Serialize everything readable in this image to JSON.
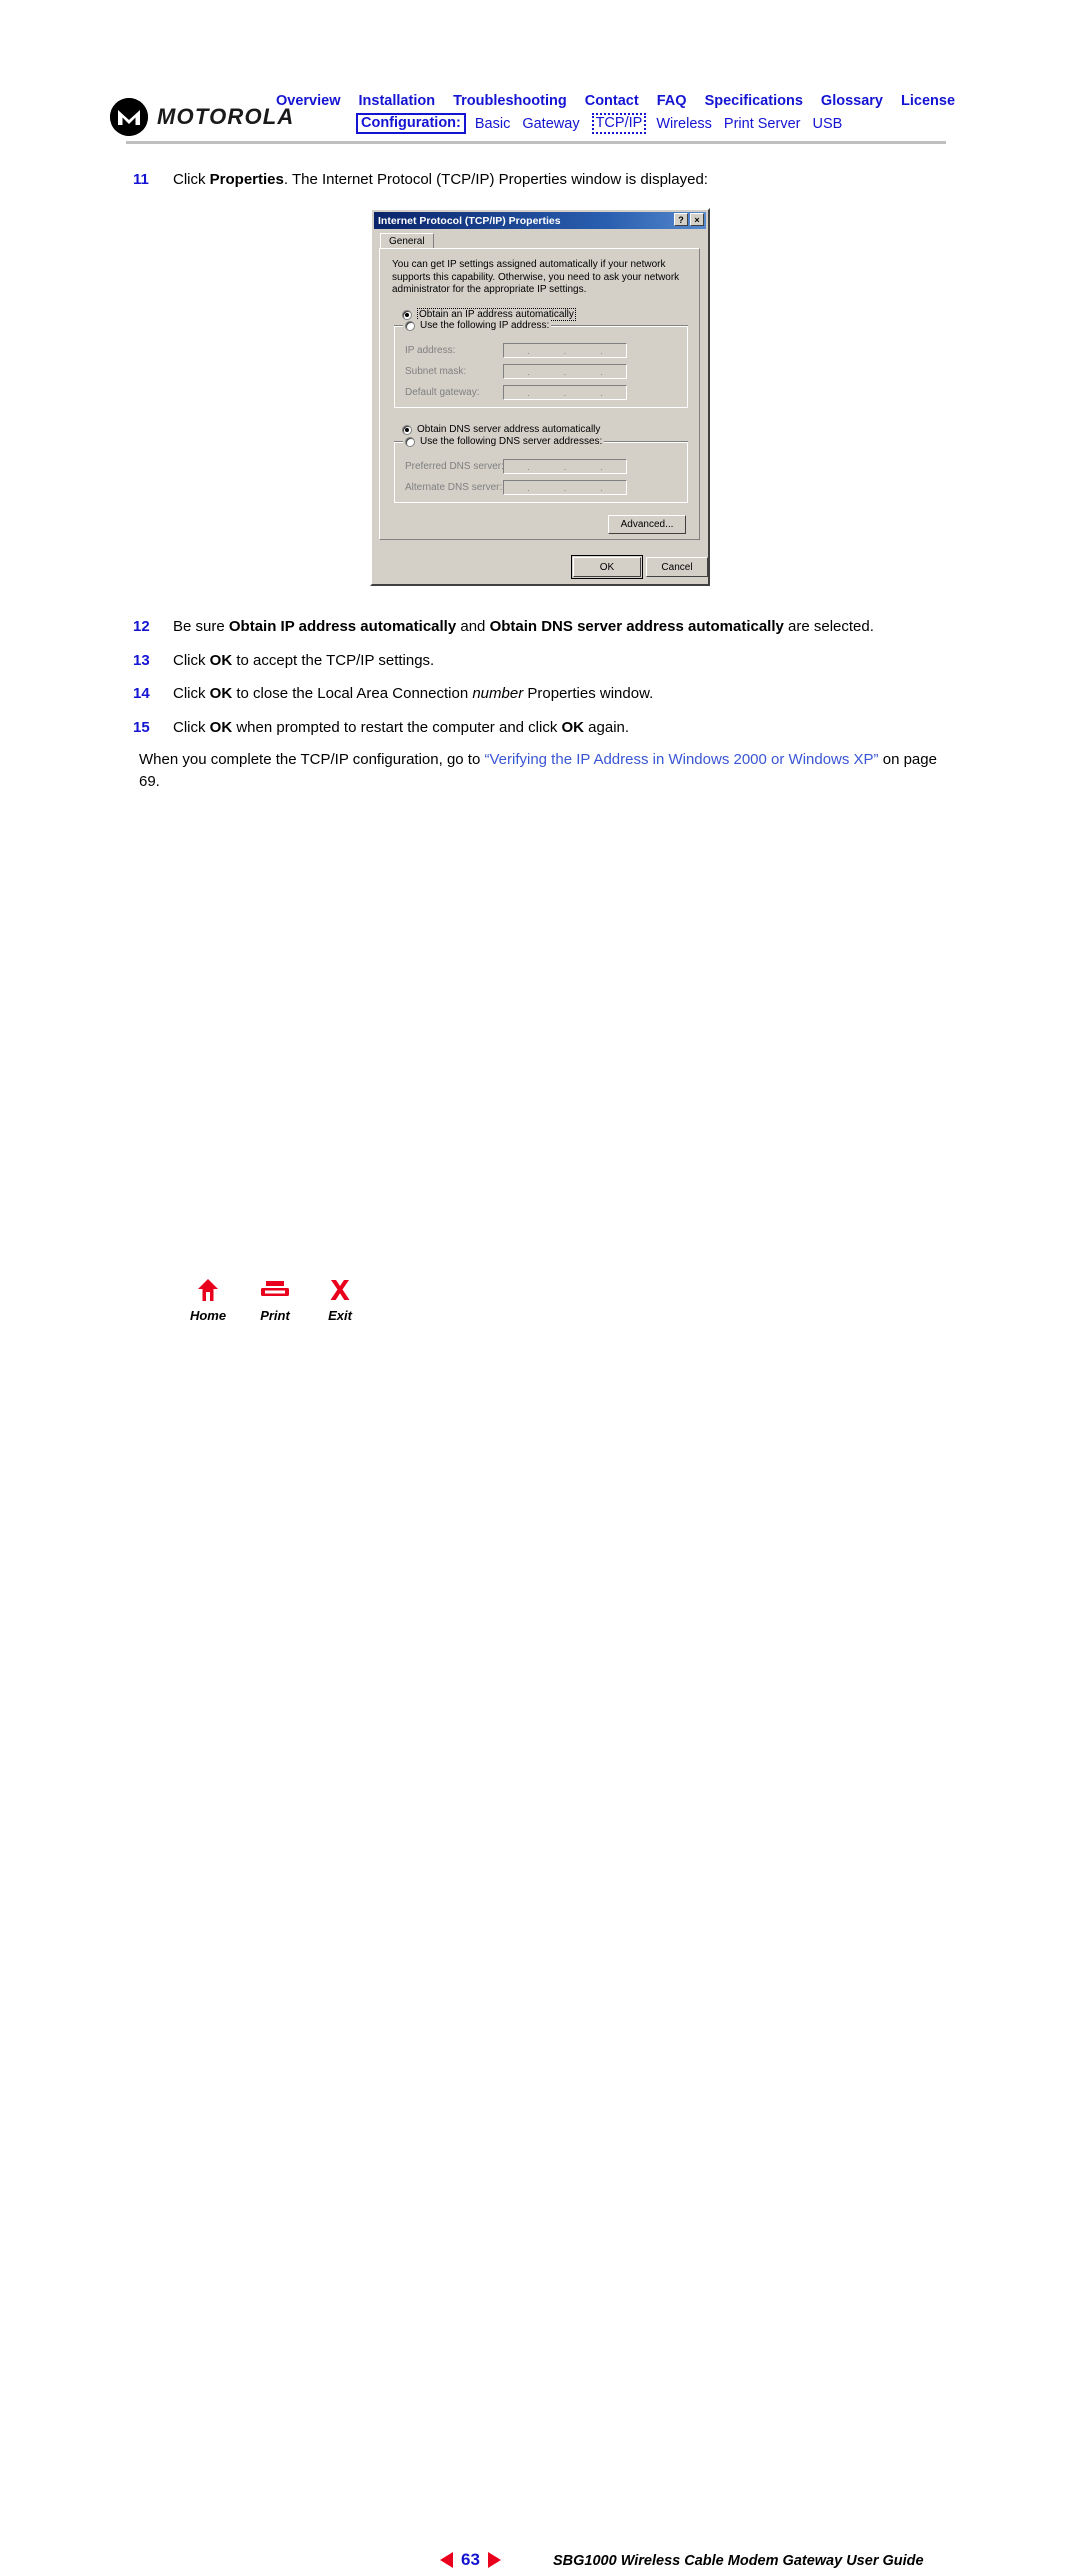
{
  "header": {
    "brand": "MOTOROLA",
    "nav_primary": [
      "Overview",
      "Installation",
      "Troubleshooting",
      "Contact",
      "FAQ",
      "Specifications",
      "Glossary",
      "License"
    ],
    "config_label": "Configuration:",
    "nav_secondary": [
      {
        "label": "Basic",
        "current": false
      },
      {
        "label": "Gateway",
        "current": false
      },
      {
        "label": "TCP/IP",
        "current": true
      },
      {
        "label": "Wireless",
        "current": false
      },
      {
        "label": "Print Server",
        "current": false
      },
      {
        "label": "USB",
        "current": false
      }
    ],
    "accent_color": "#1414d2"
  },
  "steps": {
    "s11": {
      "num": "11",
      "text_pre": "Click ",
      "bold1": "Properties",
      "text_post": ". The Internet Protocol (TCP/IP) Properties window is displayed:"
    },
    "s12": {
      "num": "12",
      "text_pre": "Be sure ",
      "bold1": "Obtain IP address automatically",
      "mid": " and ",
      "bold2": "Obtain DNS server address automatically",
      "text_post": " are selected."
    },
    "s13": {
      "num": "13",
      "text_pre": "Click ",
      "bold1": "OK",
      "text_post": " to accept the TCP/IP settings."
    },
    "s14": {
      "num": "14",
      "text_pre": "Click ",
      "bold1": "OK",
      "mid": " to close the Local Area Connection ",
      "italic1": "number",
      "text_post": " Properties window."
    },
    "s15": {
      "num": "15",
      "text_pre": "Click ",
      "bold1": "OK",
      "mid": " when prompted to restart the computer and click ",
      "bold2": "OK",
      "text_post": " again."
    }
  },
  "closing_paragraph": {
    "lead": "When you complete the TCP/IP configuration, go to ",
    "link": "“Verifying the IP Address in Windows 2000 or Windows XP”",
    "tail": " on page 69."
  },
  "dialog": {
    "title": "Internet Protocol (TCP/IP) Properties",
    "help_button": "?",
    "close_button": "×",
    "tab": "General",
    "intro": "You can get IP settings assigned automatically if your network supports this capability. Otherwise, you need to ask your network administrator for the appropriate IP settings.",
    "radio_auto_ip": "Obtain an IP address automatically",
    "group_static_ip": "Use the following IP address:",
    "fields_ip": [
      {
        "label": "IP address:",
        "value": ""
      },
      {
        "label": "Subnet mask:",
        "value": ""
      },
      {
        "label": "Default gateway:",
        "value": ""
      }
    ],
    "radio_auto_dns": "Obtain DNS server address automatically",
    "group_static_dns": "Use the following DNS server addresses:",
    "fields_dns": [
      {
        "label": "Preferred DNS server:",
        "value": ""
      },
      {
        "label": "Alternate DNS server:",
        "value": ""
      }
    ],
    "advanced_button": "Advanced...",
    "ok_button": "OK",
    "cancel_button": "Cancel",
    "ip_separator": "."
  },
  "footer": {
    "home_label": "Home",
    "print_label": "Print",
    "exit_label": "Exit",
    "page_number": "63",
    "guide_title": "SBG1000 Wireless Cable Modem Gateway User Guide",
    "nav_arrow_color": "#e8001c"
  }
}
